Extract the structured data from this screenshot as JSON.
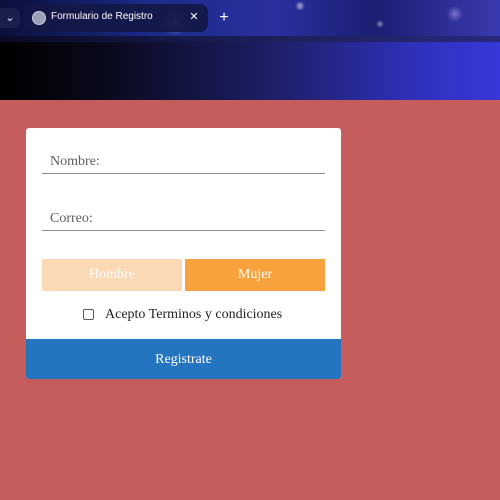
{
  "browser": {
    "tab_title": "Formulario de Registro",
    "tab_dropdown_icon": "chevron-down-icon",
    "tab_close_icon": "close-icon",
    "new_tab_icon": "plus-icon"
  },
  "form": {
    "name_placeholder": "Nombre:",
    "email_placeholder": "Correo:",
    "gender_options": [
      "Hombre",
      "Mujer"
    ],
    "terms_label": "Acepto Terminos y condiciones",
    "terms_checked": false,
    "submit_label": "Registrate"
  },
  "colors": {
    "page_background": "#c55d5c",
    "male_button": "#fbd9b5",
    "female_button": "#f8a23d",
    "submit_button": "#2474c0"
  }
}
